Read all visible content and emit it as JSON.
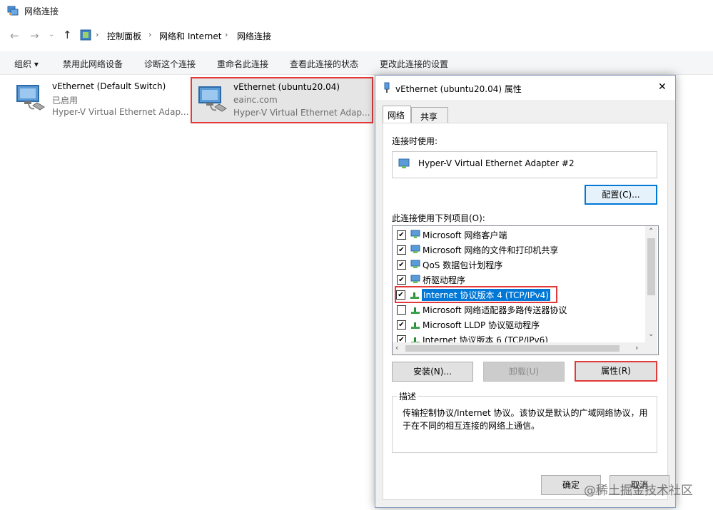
{
  "window": {
    "title": "网络连接"
  },
  "address": {
    "breadcrumbs": [
      "控制面板",
      "网络和 Internet",
      "网络连接"
    ]
  },
  "toolbar": {
    "items": [
      "组织 ▾",
      "禁用此网络设备",
      "诊断这个连接",
      "重命名此连接",
      "查看此连接的状态",
      "更改此连接的设置"
    ]
  },
  "adapters": [
    {
      "name": "vEthernet (Default Switch)",
      "status": "已启用",
      "device": "Hyper-V Virtual Ethernet Adap..."
    },
    {
      "name": "vEthernet (ubuntu20.04)",
      "status": "eainc.com",
      "device": "Hyper-V Virtual Ethernet Adap..."
    }
  ],
  "dialog": {
    "title": "vEthernet (ubuntu20.04) 属性",
    "close_label": "✕",
    "tabs": [
      "网络",
      "共享"
    ],
    "connect_using_label": "连接时使用:",
    "adapter_name": "Hyper-V Virtual Ethernet Adapter #2",
    "configure_label": "配置(C)...",
    "items_label": "此连接使用下列项目(O):",
    "items": [
      {
        "label": "Microsoft 网络客户端",
        "checked": true,
        "icon": "network-client-icon"
      },
      {
        "label": "Microsoft 网络的文件和打印机共享",
        "checked": true,
        "icon": "network-service-icon"
      },
      {
        "label": "QoS 数据包计划程序",
        "checked": true,
        "icon": "network-service-icon"
      },
      {
        "label": "桥驱动程序",
        "checked": true,
        "icon": "network-service-icon"
      },
      {
        "label": "Internet 协议版本 4 (TCP/IPv4)",
        "checked": true,
        "icon": "protocol-icon"
      },
      {
        "label": "Microsoft 网络适配器多路传送器协议",
        "checked": false,
        "icon": "protocol-icon"
      },
      {
        "label": "Microsoft LLDP 协议驱动程序",
        "checked": true,
        "icon": "protocol-icon"
      },
      {
        "label": "Internet 协议版本 6 (TCP/IPv6)",
        "checked": true,
        "icon": "protocol-icon"
      }
    ],
    "install_label": "安装(N)...",
    "uninstall_label": "卸载(U)",
    "properties_label": "属性(R)",
    "description_label": "描述",
    "description_text": "传输控制协议/Internet 协议。该协议是默认的广域网络协议，用于在不同的相互连接的网络上通信。",
    "ok_label": "确定",
    "cancel_label": "取消"
  },
  "watermark": "@稀土掘金技术社区",
  "colors": {
    "selection": "#0078d7",
    "highlight_border": "#e23a3a",
    "selected_adapter_bg": "#e5e5e5"
  }
}
